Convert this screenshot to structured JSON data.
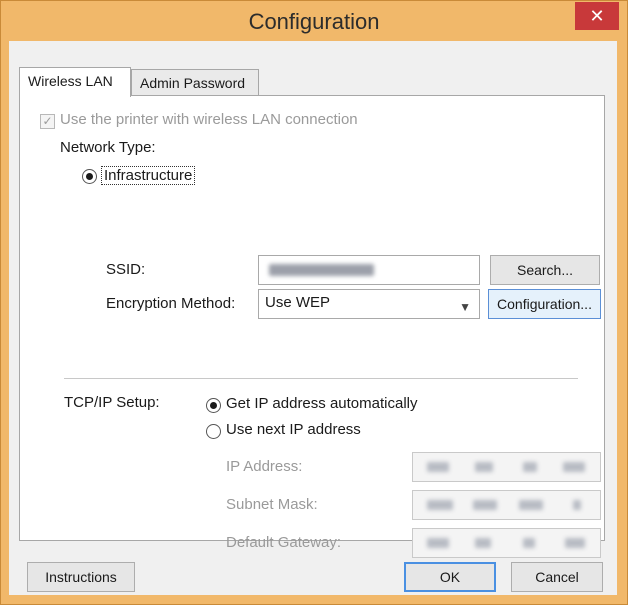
{
  "window": {
    "title": "Configuration",
    "close_glyph": "✕"
  },
  "tabs": [
    {
      "label": "Wireless LAN",
      "active": true
    },
    {
      "label": "Admin Password",
      "active": false
    }
  ],
  "wireless": {
    "use_wireless_label": "Use the printer with wireless LAN connection",
    "use_wireless_checked": true,
    "network_type_label": "Network Type:",
    "infrastructure_label": "Infrastructure",
    "ssid_label": "SSID:",
    "search_button": "Search...",
    "encryption_label": "Encryption Method:",
    "encryption_value": "Use WEP",
    "configuration_button": "Configuration..."
  },
  "tcpip": {
    "label": "TCP/IP Setup:",
    "auto_label": "Get IP address automatically",
    "manual_label": "Use next IP address",
    "ip_address_label": "IP Address:",
    "subnet_mask_label": "Subnet Mask:",
    "default_gateway_label": "Default Gateway:"
  },
  "footer": {
    "instructions_button": "Instructions",
    "ok_button": "OK",
    "cancel_button": "Cancel"
  },
  "icons": [
    "close-icon",
    "checkbox-checked-icon",
    "radio-selected-icon",
    "radio-empty-icon",
    "chevron-down-icon"
  ],
  "colors": {
    "title_bar": "#f1b86a",
    "close_button": "#c8393a",
    "focus_accent": "#4a90e2"
  }
}
